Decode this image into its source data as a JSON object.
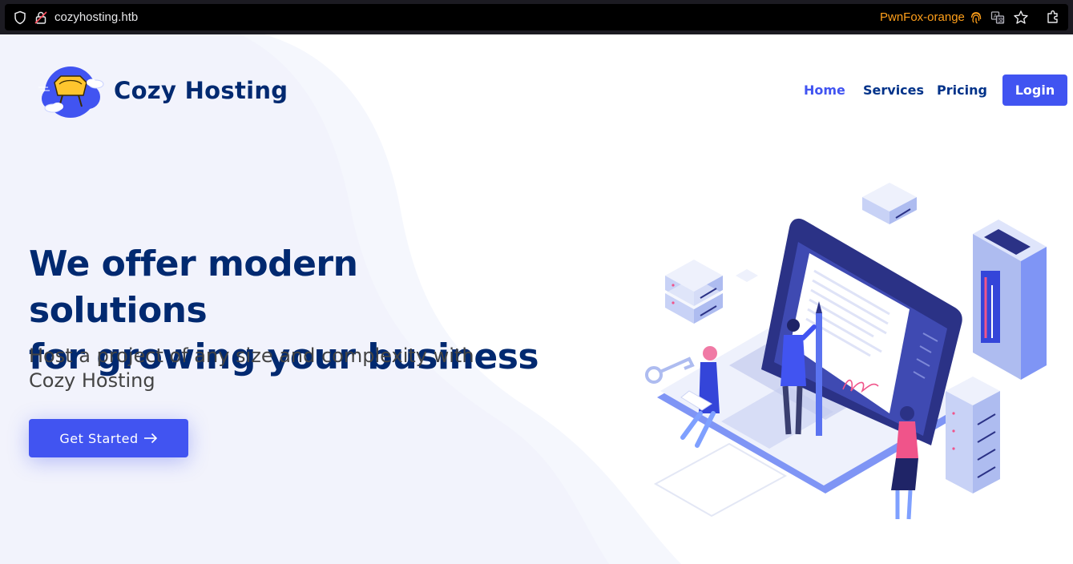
{
  "browser": {
    "url": "cozyhosting.htb",
    "container_label": "PwnFox-orange",
    "icons": [
      "shield-icon",
      "lock-icon",
      "fingerprint-icon",
      "translate-icon",
      "star-icon",
      "extension-icon"
    ],
    "container_color": "#ff9f1a"
  },
  "header": {
    "brand": "Cozy Hosting",
    "nav": {
      "home": "Home",
      "services": "Services",
      "pricing": "Pricing"
    },
    "login": "Login"
  },
  "hero": {
    "title_line1": "We offer modern solutions",
    "title_line2": "for growing your business",
    "subtitle": "Host a project of any size and complexity with Cozy Hosting",
    "cta": "Get Started"
  },
  "colors": {
    "accent": "#4154f1",
    "heading": "#012970",
    "nav_text": "#013289"
  }
}
